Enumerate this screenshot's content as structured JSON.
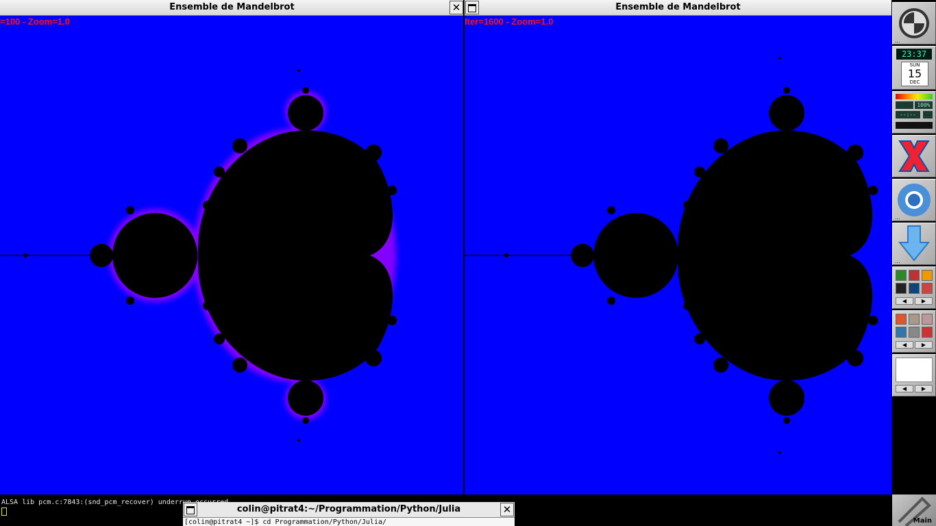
{
  "windows": [
    {
      "title": "Ensemble de Mandelbrot",
      "overlay": "=100 - Zoom=1.0",
      "close_glyph": "✕"
    },
    {
      "title": "Ensemble de Mandelbrot",
      "overlay": "Iter=1600 - Zoom=1.0"
    }
  ],
  "dock": {
    "clock": "23:37",
    "day": "SUN",
    "date": "15",
    "month": "DEC",
    "volume": "100%",
    "time_placeholder": "--:--",
    "ellipsis": "...",
    "scroll_left": "◀",
    "scroll_right": "▶"
  },
  "terminal": {
    "line1": "ALSA lib pcm.c:7843:(snd_pcm_recover) underrun occurred",
    "title": "colin@pitrat4:~/Programmation/Python/Julia",
    "close_glyph": "✕",
    "prompt": "[colin@pitrat4 ~]$ cd Programmation/Python/Julia/"
  },
  "main_label": "Main",
  "colors": {
    "desktop_blue": "#0000ff",
    "fringe_magenta": "#cc33ff",
    "overlay_red": "#ff1010"
  }
}
